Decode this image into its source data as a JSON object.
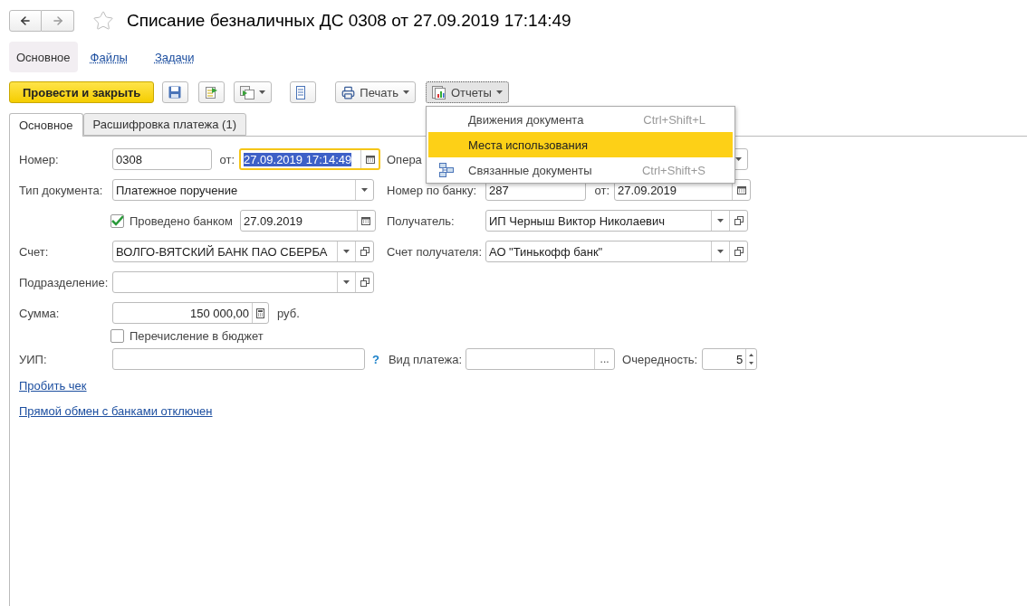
{
  "window": {
    "title": "Списание безналичных ДС 0308 от 27.09.2019 17:14:49",
    "starred": false
  },
  "sections": [
    {
      "label": "Основное",
      "selected": true
    },
    {
      "label": "Файлы",
      "selected": false
    },
    {
      "label": "Задачи",
      "selected": false
    }
  ],
  "toolbar": {
    "primary": "Провести и закрыть",
    "print": "Печать",
    "reports": {
      "label": "Отчеты",
      "expanded": true
    }
  },
  "tabs": [
    {
      "label": "Основное",
      "selected": true
    },
    {
      "label": "Расшифровка платежа (1)",
      "selected": false
    }
  ],
  "form": {
    "number": {
      "label": "Номер:",
      "value": "0308"
    },
    "date": {
      "label": "от:",
      "value": "27.09.2019 17:14:49",
      "focused": true
    },
    "operation": {
      "label": "Опера"
    },
    "doc_type": {
      "label": "Тип документа:",
      "value": "Платежное поручение"
    },
    "bank_number": {
      "label": "Номер по банку:",
      "value": "287"
    },
    "bank_date": {
      "label": "от:",
      "value": "27.09.2019"
    },
    "bank_done": {
      "label": "Проведено банком",
      "checked": true,
      "date": "27.09.2019"
    },
    "recipient": {
      "label": "Получатель:",
      "value": "ИП Черныш Виктор Николаевич"
    },
    "account": {
      "label": "Счет:",
      "value": "ВОЛГО-ВЯТСКИЙ БАНК ПАО СБЕРБА"
    },
    "recipient_account": {
      "label": "Счет получателя:",
      "value": "АО \"Тинькофф банк\""
    },
    "department": {
      "label": "Подразделение:"
    },
    "amount": {
      "label": "Сумма:",
      "value": "150 000,00",
      "unit": "руб."
    },
    "budget": {
      "label": "Перечисление в бюджет",
      "checked": false
    },
    "uip": {
      "label": "УИП:",
      "help": "?"
    },
    "payment_kind": {
      "label": "Вид платежа:",
      "button": "..."
    },
    "priority": {
      "label": "Очередность:",
      "value": "5"
    }
  },
  "links": [
    "Пробить чек",
    "Прямой обмен с банками отключен"
  ],
  "reports_menu": {
    "items": [
      {
        "label": "Движения документа",
        "shortcut": "Ctrl+Shift+L",
        "selected": false,
        "kind": "plain"
      },
      {
        "label": "Места использования",
        "selected": true,
        "kind": "plain"
      },
      {
        "label": "Связанные документы",
        "shortcut": "Ctrl+Shift+S",
        "selected": false,
        "kind": "related"
      }
    ]
  }
}
